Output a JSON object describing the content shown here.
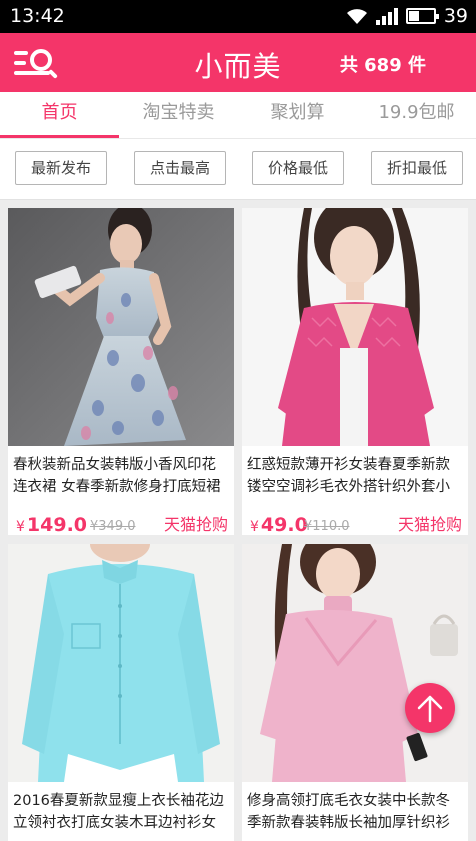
{
  "status_bar": {
    "time": "13:42",
    "battery": "39"
  },
  "header": {
    "logo": "小而美",
    "count": "共 689 件",
    "brand_color": "#f43569"
  },
  "tabs": [
    {
      "label": "首页",
      "active": true
    },
    {
      "label": "淘宝特卖",
      "active": false
    },
    {
      "label": "聚划算",
      "active": false
    },
    {
      "label": "19.9包邮",
      "active": false
    }
  ],
  "filters": [
    "最新发布",
    "点击最高",
    "价格最低",
    "折扣最低"
  ],
  "products": [
    {
      "title": "春秋装新品女装韩版小香风印花连衣裙 女春季新款修身打底短裙",
      "price": "149.0",
      "old_price": "¥349.0",
      "buy_label": "天猫抢购",
      "currency": "¥"
    },
    {
      "title": "红惑短款薄开衫女装春夏季新款镂空空调衫毛衣外搭针织外套小",
      "price": "49.0",
      "old_price": "¥110.0",
      "buy_label": "天猫抢购",
      "currency": "¥"
    },
    {
      "title": "2016春夏新款显瘦上衣长袖花边立领衬衣打底女装木耳边衬衫女",
      "price": "",
      "old_price": "",
      "buy_label": "",
      "currency": ""
    },
    {
      "title": "修身高领打底毛衣女装中长款冬季新款春装韩版长袖加厚针织衫",
      "price": "",
      "old_price": "",
      "buy_label": "",
      "currency": ""
    }
  ]
}
